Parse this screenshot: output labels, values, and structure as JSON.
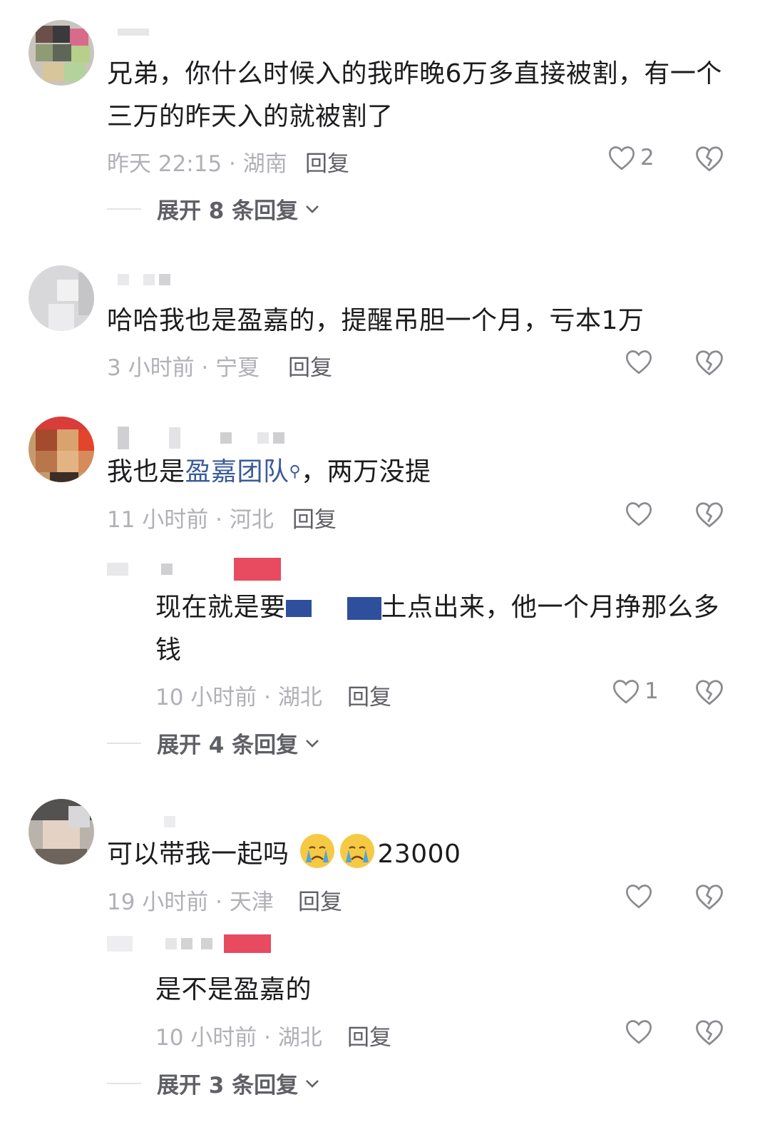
{
  "colors": {
    "accent_link": "#3a5a9a",
    "meta": "#b0b0b6",
    "text": "#1c1c1e"
  },
  "comments": [
    {
      "text": "兄弟，你什么时候入的我昨晚6万多直接被割，有一个三万的昨天入的就被割了",
      "meta": "昨天 22:15 · 湖南",
      "reply": "回复",
      "likes": "2",
      "expand": "展开 8 条回复"
    },
    {
      "text": "哈哈我也是盈嘉的，提醒吊胆一个月，亏本1万",
      "meta": "3 小时前 · 宁夏",
      "reply": "回复",
      "likes": ""
    },
    {
      "text_prefix": "我也是",
      "text_link": "盈嘉团队",
      "text_suffix": "，两万没提",
      "meta": "11 小时前 · 河北",
      "reply": "回复",
      "likes": "",
      "sub": {
        "text_a": "现在就是要",
        "text_b": "土点出来，他一个月挣那么多钱",
        "meta": "10 小时前 · 湖北",
        "reply": "回复",
        "likes": "1",
        "expand": "展开 4 条回复"
      }
    },
    {
      "text": "可以带我一起吗",
      "text_after": "23000",
      "meta": "19 小时前 · 天津",
      "reply": "回复",
      "likes": "",
      "sub": {
        "text": "是不是盈嘉的",
        "meta": "10 小时前 · 湖北",
        "reply": "回复",
        "likes": "",
        "expand": "展开 3 条回复"
      }
    }
  ],
  "icons": {
    "like": "heart-outline-icon",
    "dislike": "broken-heart-icon",
    "expand": "chevron-down-icon",
    "emoji": "crying-face-emoji"
  }
}
